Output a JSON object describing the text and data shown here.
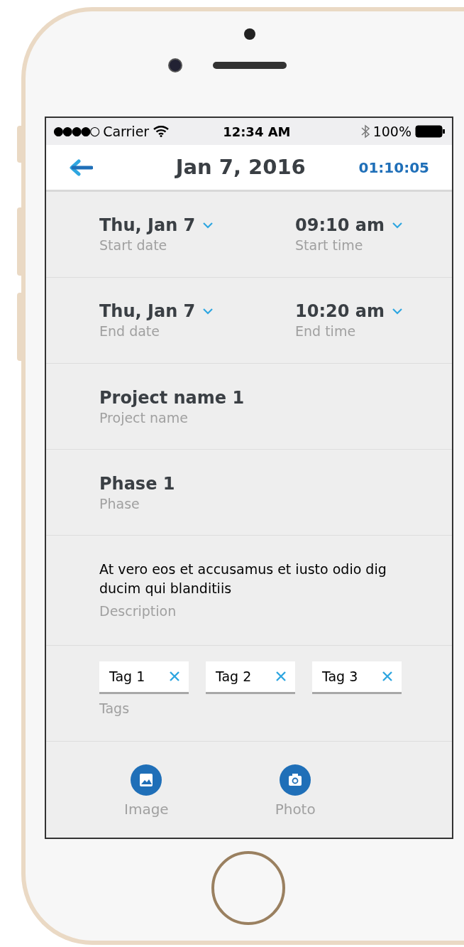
{
  "status_bar": {
    "signal": "●●●●○",
    "carrier": "Carrier",
    "time": "12:34 AM",
    "battery": "100%"
  },
  "header": {
    "title": "Jan 7, 2016",
    "timer": "01:10:05"
  },
  "schedule": [
    {
      "date": {
        "value": "Thu, Jan 7",
        "label": "Start date"
      },
      "time": {
        "value": "09:10 am",
        "label": "Start time"
      }
    },
    {
      "date": {
        "value": "Thu, Jan 7",
        "label": "End date"
      },
      "time": {
        "value": "10:20 am",
        "label": "End time"
      }
    }
  ],
  "fields": [
    {
      "value": "Project name 1",
      "label": "Project name"
    },
    {
      "value": "Phase 1",
      "label": "Phase"
    }
  ],
  "description": {
    "value": "At vero eos et accusamus et iusto odio dig ducim qui blanditiis",
    "label": "Description"
  },
  "tags": {
    "items": [
      "Tag 1",
      "Tag 2",
      "Tag 3"
    ],
    "label": "Tags"
  },
  "attachments": [
    {
      "kind": "image",
      "label": "Image"
    },
    {
      "kind": "photo",
      "label": "Photo"
    }
  ]
}
